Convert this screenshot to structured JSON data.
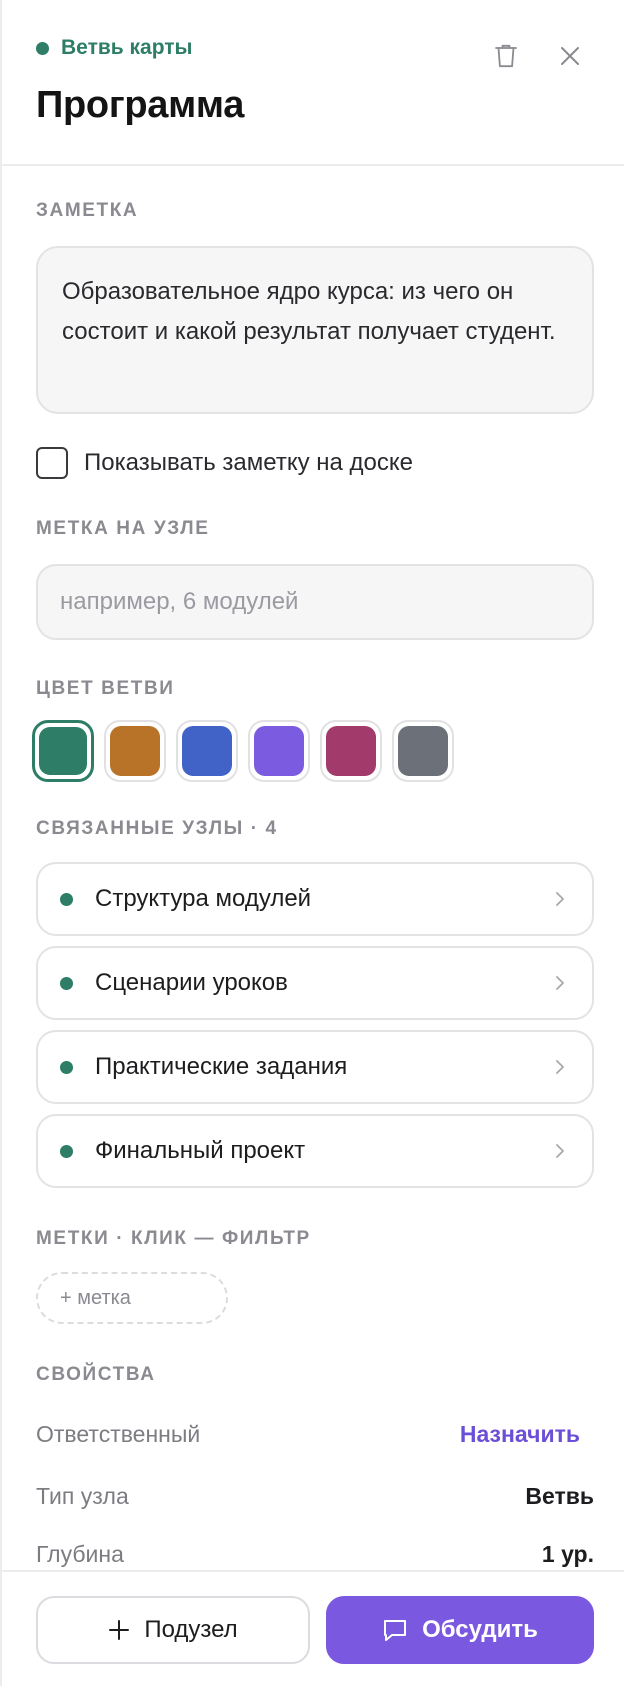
{
  "header": {
    "branch_tag": "Ветвь карты",
    "title": "Программа"
  },
  "note": {
    "section_label": "ЗАМЕТКА",
    "text": "Образовательное ядро курса: из чего он состоит и какой результат получает студент.",
    "show_on_board_label": "Показывать заметку на доске",
    "show_on_board_checked": false
  },
  "node_label": {
    "section_label": "МЕТКА НА УЗЛЕ",
    "placeholder": "например, 6 модулей",
    "value": ""
  },
  "branch_color": {
    "section_label": "ЦВЕТ ВЕТВИ",
    "colors": [
      "#2e7d67",
      "#b87328",
      "#4163c8",
      "#7b5ce0",
      "#a33a6c",
      "#6c7078"
    ],
    "selected": "#2e7d67"
  },
  "related": {
    "section_label": "СВЯЗАННЫЕ УЗЛЫ · 4",
    "items": [
      {
        "name": "Структура модулей"
      },
      {
        "name": "Сценарии уроков"
      },
      {
        "name": "Практические задания"
      },
      {
        "name": "Финальный проект"
      }
    ]
  },
  "tags": {
    "section_label": "МЕТКИ · КЛИК — ФИЛЬТР",
    "add_label": "+ метка"
  },
  "properties": {
    "section_label": "СВОЙСТВА",
    "owner_key": "Ответственный",
    "owner_action": "Назначить",
    "type_key": "Тип узла",
    "type_value": "Ветвь",
    "depth_key": "Глубина",
    "depth_value": "1 ур."
  },
  "footer": {
    "subnode_label": "Подузел",
    "discuss_label": "Обсудить"
  },
  "colors": {
    "accent": "#7b58e0",
    "branch": "#2e7d67"
  }
}
